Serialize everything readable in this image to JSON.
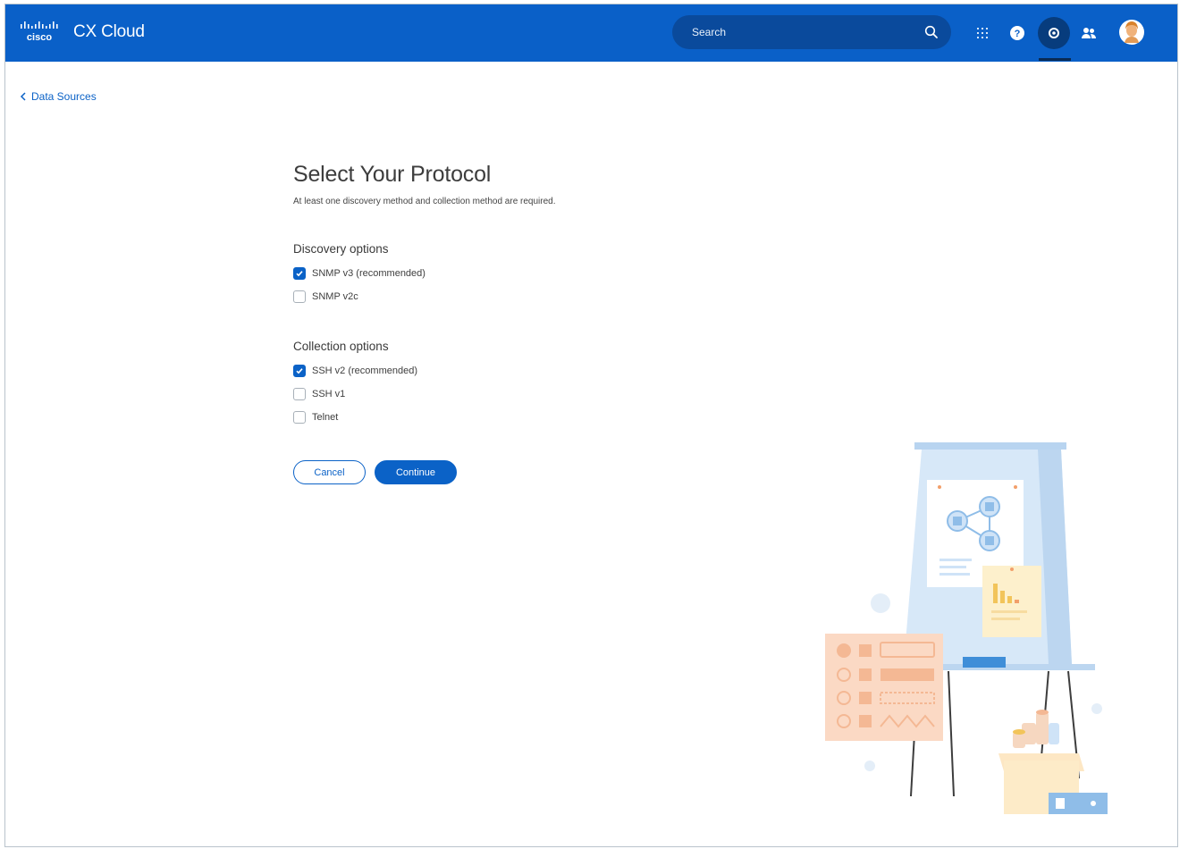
{
  "header": {
    "logo_text": "cisco",
    "app_title": "CX Cloud",
    "search": {
      "placeholder": "Search",
      "value": ""
    },
    "icons": [
      "apps-grid-icon",
      "help-icon",
      "settings-icon",
      "users-icon",
      "user-avatar"
    ]
  },
  "nav": {
    "back_label": "Data Sources"
  },
  "form": {
    "title": "Select Your Protocol",
    "subtitle": "At least one discovery method and collection method are required.",
    "discovery": {
      "title": "Discovery options",
      "options": [
        {
          "label": "SNMP v3 (recommended)",
          "checked": true
        },
        {
          "label": "SNMP v2c",
          "checked": false
        }
      ]
    },
    "collection": {
      "title": "Collection options",
      "options": [
        {
          "label": "SSH v2 (recommended)",
          "checked": true
        },
        {
          "label": "SSH v1",
          "checked": false
        },
        {
          "label": "Telnet",
          "checked": false
        }
      ]
    },
    "cancel_label": "Cancel",
    "continue_label": "Continue"
  },
  "colors": {
    "brand_blue": "#0a60c8",
    "search_bg": "#0a4a9c",
    "accent": "#0b62c7"
  }
}
